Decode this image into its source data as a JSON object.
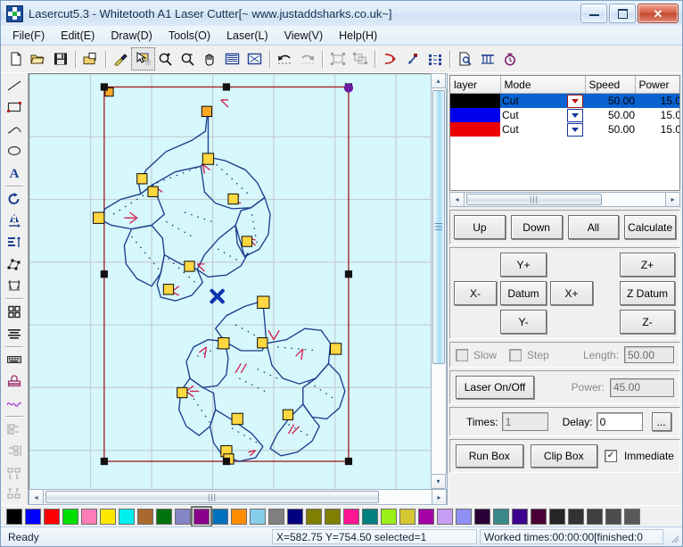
{
  "window": {
    "title": "Lasercut5.3 - Whitetooth A1 Laser Cutter[~ www.justaddsharks.co.uk~]",
    "app_icon": "lasercut-app-icon",
    "minimize_label": "Minimize",
    "maximize_label": "Maximize",
    "close_label": "Close"
  },
  "menu": {
    "items": [
      {
        "label": "File(F)",
        "name": "menu-file"
      },
      {
        "label": "Edit(E)",
        "name": "menu-edit"
      },
      {
        "label": "Draw(D)",
        "name": "menu-draw"
      },
      {
        "label": "Tools(O)",
        "name": "menu-tools"
      },
      {
        "label": "Laser(L)",
        "name": "menu-laser"
      },
      {
        "label": "View(V)",
        "name": "menu-view"
      },
      {
        "label": "Help(H)",
        "name": "menu-help"
      }
    ]
  },
  "toolbar": {
    "items": [
      {
        "name": "new-document-icon",
        "tip": "New"
      },
      {
        "name": "open-folder-icon",
        "tip": "Open"
      },
      {
        "name": "save-disk-icon",
        "tip": "Save"
      },
      {
        "name": "sep"
      },
      {
        "name": "export-icon",
        "tip": "Export"
      },
      {
        "name": "sep"
      },
      {
        "name": "eyedropper-icon",
        "tip": "Pick Color"
      },
      {
        "name": "select-arrow-icon",
        "tip": "Select",
        "selected": true
      },
      {
        "name": "zoom-in-icon",
        "tip": "Zoom In"
      },
      {
        "name": "zoom-out-icon",
        "tip": "Zoom Out"
      },
      {
        "name": "pan-hand-icon",
        "tip": "Pan"
      },
      {
        "name": "fit-page-icon",
        "tip": "Fit Page"
      },
      {
        "name": "fit-selection-icon",
        "tip": "Fit Selection"
      },
      {
        "name": "sep"
      },
      {
        "name": "undo-icon",
        "tip": "Undo"
      },
      {
        "name": "redo-icon",
        "tip": "Redo"
      },
      {
        "name": "sep"
      },
      {
        "name": "group-icon",
        "tip": "Group"
      },
      {
        "name": "ungroup-icon",
        "tip": "Ungroup"
      },
      {
        "name": "sep"
      },
      {
        "name": "arrow-path-icon",
        "tip": "Set Start Point"
      },
      {
        "name": "node-direction-icon",
        "tip": "Cut Direction"
      },
      {
        "name": "order-list-icon",
        "tip": "Cut Order"
      },
      {
        "name": "sep"
      },
      {
        "name": "preview-icon",
        "tip": "Preview"
      },
      {
        "name": "cut-array-icon",
        "tip": "Array"
      },
      {
        "name": "estimate-time-icon",
        "tip": "Estimate Time"
      }
    ]
  },
  "left_toolbar": {
    "items": [
      {
        "name": "line-tool-icon",
        "tip": "Line"
      },
      {
        "name": "rectangle-tool-icon",
        "tip": "Rectangle"
      },
      {
        "name": "polyline-tool-icon",
        "tip": "Polyline"
      },
      {
        "name": "ellipse-tool-icon",
        "tip": "Ellipse"
      },
      {
        "name": "text-tool-icon",
        "tip": "Text"
      },
      {
        "name": "sep"
      },
      {
        "name": "rotate-tool-icon",
        "tip": "Rotate"
      },
      {
        "name": "mirror-horizontal-icon",
        "tip": "Mirror Horizontal"
      },
      {
        "name": "mirror-vertical-icon",
        "tip": "Mirror Vertical"
      },
      {
        "name": "node-edit-icon",
        "tip": "Node Edit"
      },
      {
        "name": "transform-icon",
        "tip": "Transform"
      },
      {
        "name": "sep"
      },
      {
        "name": "array-copy-icon",
        "tip": "Array Copy"
      },
      {
        "name": "align-text-icon",
        "tip": "Align"
      },
      {
        "name": "sep"
      },
      {
        "name": "keyboard-icon",
        "tip": "Keyboard Input"
      },
      {
        "name": "stamp-icon",
        "tip": "Stamp"
      },
      {
        "name": "curve-smooth-icon",
        "tip": "Smooth Curve"
      }
    ],
    "disabled_items": [
      {
        "name": "align-left-icon",
        "tip": "Align Left"
      },
      {
        "name": "align-right-icon",
        "tip": "Align Right"
      },
      {
        "name": "align-top-icon",
        "tip": "Align Top"
      },
      {
        "name": "align-bottom-icon",
        "tip": "Align Bottom"
      }
    ]
  },
  "layer_panel": {
    "columns": [
      "layer",
      "Mode",
      "Speed",
      "Power"
    ],
    "rows": [
      {
        "color": "#000000",
        "mode": "Cut",
        "speed": "50.00",
        "power": "15.0",
        "selected": true
      },
      {
        "color": "#0000ee",
        "mode": "Cut",
        "speed": "50.00",
        "power": "15.0",
        "selected": false
      },
      {
        "color": "#ee0000",
        "mode": "Cut",
        "speed": "50.00",
        "power": "15.0",
        "selected": false
      }
    ],
    "scroll_left_icon": "scroll-left-arrow-icon",
    "scroll_right_icon": "scroll-right-arrow-icon",
    "thumb_grip": "|||"
  },
  "controls": {
    "order_buttons": [
      {
        "label": "Up",
        "name": "layer-up-button"
      },
      {
        "label": "Down",
        "name": "layer-down-button"
      },
      {
        "label": "All",
        "name": "layer-all-button"
      },
      {
        "label": "Calculate",
        "name": "calculate-button"
      }
    ],
    "jog": {
      "y_plus": "Y+",
      "y_minus": "Y-",
      "x_plus": "X+",
      "x_minus": "X-",
      "datum": "Datum",
      "z_plus": "Z+",
      "z_minus": "Z-",
      "z_datum": "Z Datum"
    },
    "move_options": {
      "slow_label": "Slow",
      "slow_checked": false,
      "step_label": "Step",
      "step_checked": false,
      "length_label": "Length:",
      "length_value": "50.00"
    },
    "laser": {
      "toggle_label": "Laser On/Off",
      "power_label": "Power:",
      "power_value": "45.00"
    },
    "repeat": {
      "times_label": "Times:",
      "times_value": "1",
      "delay_label": "Delay:",
      "delay_value": "0",
      "more_label": "..."
    },
    "run": {
      "run_box_label": "Run Box",
      "clip_box_label": "Clip Box",
      "immediate_label": "Immediate",
      "immediate_checked": true,
      "check_glyph": "✓"
    }
  },
  "palette": {
    "active_index": 10,
    "colors": [
      "#000000",
      "#0000ff",
      "#ff0000",
      "#00e000",
      "#ff7cb8",
      "#ffe800",
      "#00f0f0",
      "#a9692e",
      "#00730d",
      "#8385c4",
      "#8b008b",
      "#0071bc",
      "#ff8c00",
      "#87ceeb",
      "#808080",
      "#000080",
      "#808000",
      "#7f7f00",
      "#ff1493",
      "#008080",
      "#9bf017",
      "#d4c630",
      "#a400a4",
      "#c89ef5",
      "#8f90f5",
      "#2a0036",
      "#3b8a8a",
      "#3d008f",
      "#4a0036",
      "#262626",
      "#333333",
      "#404040",
      "#4d4d4d",
      "#595959"
    ]
  },
  "canvas": {
    "background": "#d6f7fb",
    "grid_color": "#c3cfd2",
    "selection_color": "#a02020",
    "shape_color": "#1a3c8c",
    "node_color": "#ffd740",
    "arrow_color": "#d02050",
    "origin_marker": "origin-cross-marker"
  },
  "scrollbars": {
    "left_arrow": "◂",
    "right_arrow": "▸",
    "up_arrow": "▴",
    "down_arrow": "▾",
    "grip": "|||"
  },
  "statusbar": {
    "ready": "Ready",
    "coords": "X=582.75 Y=754.50 selected=1",
    "worked": "Worked times:00:00:00[finished:0",
    "resize_grip": "resize-grip-icon"
  }
}
